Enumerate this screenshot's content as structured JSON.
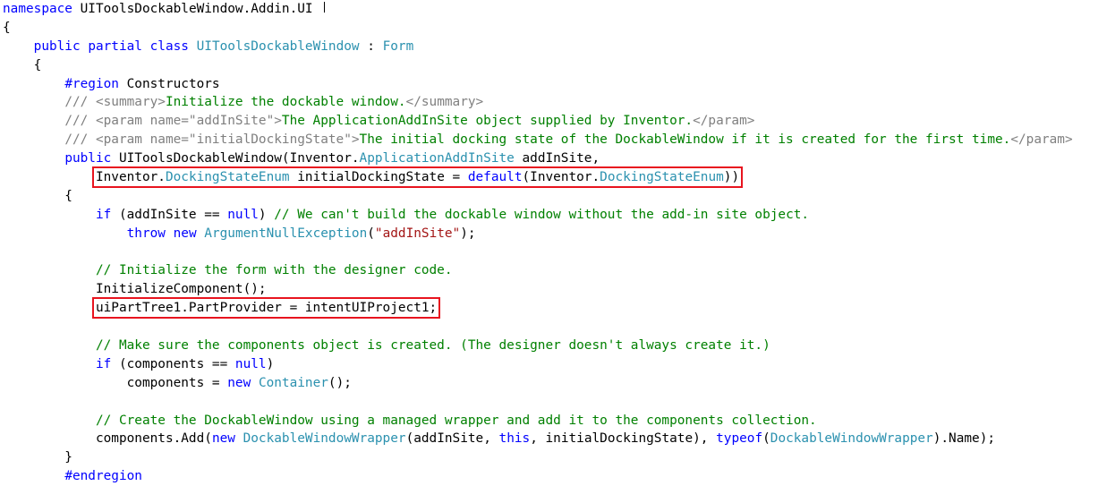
{
  "editor": {
    "language": "C#",
    "colors": {
      "keyword": "#0000ff",
      "type": "#2b91af",
      "string": "#a31515",
      "comment": "#008000",
      "doc_tag": "#808080",
      "plain": "#000000",
      "highlight_box": "#e8141f"
    },
    "lines": [
      [
        {
          "t": "namespace",
          "c": "kw"
        },
        {
          "t": " UIToolsDockableWindow.Addin.UI",
          "c": "plain"
        }
      ],
      [
        {
          "t": "{",
          "c": "plain"
        }
      ],
      [
        {
          "t": "    ",
          "c": "plain"
        },
        {
          "t": "public",
          "c": "kw"
        },
        {
          "t": " ",
          "c": "plain"
        },
        {
          "t": "partial",
          "c": "kw"
        },
        {
          "t": " ",
          "c": "plain"
        },
        {
          "t": "class",
          "c": "kw"
        },
        {
          "t": " ",
          "c": "plain"
        },
        {
          "t": "UIToolsDockableWindow",
          "c": "type"
        },
        {
          "t": " : ",
          "c": "plain"
        },
        {
          "t": "Form",
          "c": "type"
        }
      ],
      [
        {
          "t": "    {",
          "c": "plain"
        }
      ],
      [
        {
          "t": "        ",
          "c": "plain"
        },
        {
          "t": "#region",
          "c": "kw"
        },
        {
          "t": " Constructors",
          "c": "plain"
        }
      ],
      [
        {
          "t": "        ",
          "c": "plain"
        },
        {
          "t": "/// <summary>",
          "c": "doc"
        },
        {
          "t": "Initialize the dockable window.",
          "c": "cm"
        },
        {
          "t": "</summary>",
          "c": "doc"
        }
      ],
      [
        {
          "t": "        ",
          "c": "plain"
        },
        {
          "t": "/// <param name=\"addInSite\">",
          "c": "doc"
        },
        {
          "t": "The ApplicationAddInSite object supplied by Inventor.",
          "c": "cm"
        },
        {
          "t": "</param>",
          "c": "doc"
        }
      ],
      [
        {
          "t": "        ",
          "c": "plain"
        },
        {
          "t": "/// <param name=\"initialDockingState\">",
          "c": "doc"
        },
        {
          "t": "The initial docking state of the DockableWindow if it is created for the first time.",
          "c": "cm"
        },
        {
          "t": "</param>",
          "c": "doc"
        }
      ],
      [
        {
          "t": "        ",
          "c": "plain"
        },
        {
          "t": "public",
          "c": "kw"
        },
        {
          "t": " UIToolsDockableWindow(Inventor.",
          "c": "plain"
        },
        {
          "t": "ApplicationAddInSite",
          "c": "type"
        },
        {
          "t": " addInSite,",
          "c": "plain"
        }
      ],
      [
        {
          "t": "            ",
          "c": "plain"
        },
        {
          "t": "Inventor.",
          "c": "plain",
          "hl": "start"
        },
        {
          "t": "DockingStateEnum",
          "c": "type"
        },
        {
          "t": " initialDockingState = ",
          "c": "plain"
        },
        {
          "t": "default",
          "c": "kw"
        },
        {
          "t": "(Inventor.",
          "c": "plain"
        },
        {
          "t": "DockingStateEnum",
          "c": "type"
        },
        {
          "t": "))",
          "c": "plain",
          "hl": "end"
        }
      ],
      [
        {
          "t": "        {",
          "c": "plain"
        }
      ],
      [
        {
          "t": "            ",
          "c": "plain"
        },
        {
          "t": "if",
          "c": "kw"
        },
        {
          "t": " (addInSite == ",
          "c": "plain"
        },
        {
          "t": "null",
          "c": "kw"
        },
        {
          "t": ") ",
          "c": "plain"
        },
        {
          "t": "// We can't build the dockable window without the add-in site object.",
          "c": "cm"
        }
      ],
      [
        {
          "t": "                ",
          "c": "plain"
        },
        {
          "t": "throw",
          "c": "kw"
        },
        {
          "t": " ",
          "c": "plain"
        },
        {
          "t": "new",
          "c": "kw"
        },
        {
          "t": " ",
          "c": "plain"
        },
        {
          "t": "ArgumentNullException",
          "c": "type"
        },
        {
          "t": "(",
          "c": "plain"
        },
        {
          "t": "\"addInSite\"",
          "c": "str"
        },
        {
          "t": ");",
          "c": "plain"
        }
      ],
      [
        {
          "t": "",
          "c": "plain"
        }
      ],
      [
        {
          "t": "            ",
          "c": "plain"
        },
        {
          "t": "// Initialize the form with the designer code.",
          "c": "cm"
        }
      ],
      [
        {
          "t": "            InitializeComponent();",
          "c": "plain"
        }
      ],
      [
        {
          "t": "            ",
          "c": "plain"
        },
        {
          "t": "uiPartTree1.PartProvider = intentUIProject1;",
          "c": "plain",
          "hl": "both"
        }
      ],
      [
        {
          "t": "",
          "c": "plain"
        }
      ],
      [
        {
          "t": "            ",
          "c": "plain"
        },
        {
          "t": "// Make sure the components object is created. (The designer doesn't always create it.)",
          "c": "cm"
        }
      ],
      [
        {
          "t": "            ",
          "c": "plain"
        },
        {
          "t": "if",
          "c": "kw"
        },
        {
          "t": " (components == ",
          "c": "plain"
        },
        {
          "t": "null",
          "c": "kw"
        },
        {
          "t": ")",
          "c": "plain"
        }
      ],
      [
        {
          "t": "                components = ",
          "c": "plain"
        },
        {
          "t": "new",
          "c": "kw"
        },
        {
          "t": " ",
          "c": "plain"
        },
        {
          "t": "Container",
          "c": "type"
        },
        {
          "t": "();",
          "c": "plain"
        }
      ],
      [
        {
          "t": "",
          "c": "plain"
        }
      ],
      [
        {
          "t": "            ",
          "c": "plain"
        },
        {
          "t": "// Create the DockableWindow using a managed wrapper and add it to the components collection.",
          "c": "cm"
        }
      ],
      [
        {
          "t": "            components.Add(",
          "c": "plain"
        },
        {
          "t": "new",
          "c": "kw"
        },
        {
          "t": " ",
          "c": "plain"
        },
        {
          "t": "DockableWindowWrapper",
          "c": "type"
        },
        {
          "t": "(addInSite, ",
          "c": "plain"
        },
        {
          "t": "this",
          "c": "kw"
        },
        {
          "t": ", initialDockingState), ",
          "c": "plain"
        },
        {
          "t": "typeof",
          "c": "kw"
        },
        {
          "t": "(",
          "c": "plain"
        },
        {
          "t": "DockableWindowWrapper",
          "c": "type"
        },
        {
          "t": ").Name);",
          "c": "plain"
        }
      ],
      [
        {
          "t": "        }",
          "c": "plain"
        }
      ],
      [
        {
          "t": "        ",
          "c": "plain"
        },
        {
          "t": "#endregion",
          "c": "kw"
        }
      ]
    ]
  }
}
